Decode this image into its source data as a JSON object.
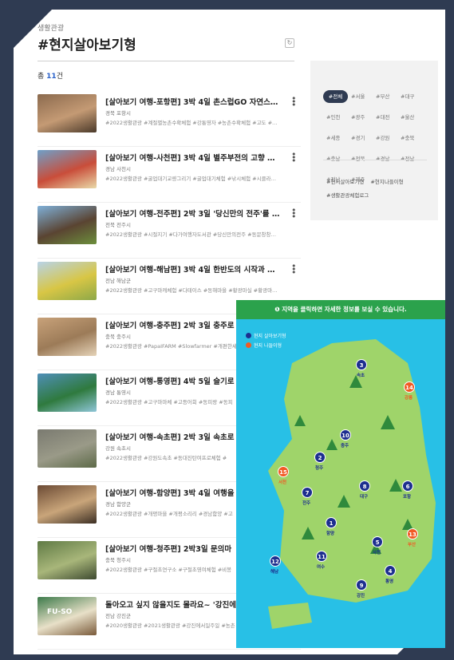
{
  "breadcrumb": "생활관광",
  "title": "#현지살아보기형",
  "count": {
    "prefix": "총 ",
    "n": "11",
    "suffix": "건"
  },
  "items": [
    {
      "title": "[살아보기 여행-포항편] 3박 4일 촌스럽GO 자연스…",
      "loc": "경북 포항시",
      "tags": "#2022생활관광 #계절별농촌수확체험 #강통영자 #농촌수확체험 #고도 #…",
      "thumb": [
        "#8b6a4e",
        "#c49a74",
        "#4b3a2a"
      ]
    },
    {
      "title": "[살아보기 여행-사천편] 3박 4일 별주부전의 고향 …",
      "loc": "경남 사천시",
      "tags": "#2022생활관광 #굴업대기교량그리기 #굴업대기체험 #낚시체험 #시클라…",
      "thumb": [
        "#6ea0c9",
        "#c94d3a",
        "#e9d9a8"
      ]
    },
    {
      "title": "[살아보기 여행-전주편] 2박 3일 '당신만의 전주'를 …",
      "loc": "전북 전주시",
      "tags": "#2022생활관광 #시절지기 #다가여행자도서관 #당신만의전주 #동문창창…",
      "thumb": [
        "#7fb0d8",
        "#5a4432",
        "#6c8f3c"
      ]
    },
    {
      "title": "[살아보기 여행-해남편] 3박 4일 한반도의 시작과 …",
      "loc": "전남 해남군",
      "tags": "#2022생활관광 #고구마캐체험 #다테이스 #동해마을 #황광마실 #황광마…",
      "thumb": [
        "#b8d3e8",
        "#d8c645",
        "#8da848"
      ]
    },
    {
      "title": "[살아보기 여행-충주편] 2박 3일 충주로",
      "loc": "충북 충주시",
      "tags": "#2022생활관광 #PapaIFARM #Slowfarmer #개편한세",
      "thumb": [
        "#c8a27a",
        "#9c7b58",
        "#e5d3b8"
      ]
    },
    {
      "title": "[살아보기 여행-통영편] 4박 5일 슬기로",
      "loc": "경남 통영시",
      "tags": "#2022생활관광 #고구마마체 #고등어회 #동피랑 #동피",
      "thumb": [
        "#4f8fb8",
        "#2f7a3e",
        "#8fc6d8"
      ]
    },
    {
      "title": "[살아보기 여행-속초편] 2박 3일 속초로",
      "loc": "강원 속초시",
      "tags": "#2022생활관광 #강원도속초 #동대진탄여프로체험 #",
      "thumb": [
        "#7a7a70",
        "#9a9a88",
        "#5d6a48"
      ]
    },
    {
      "title": "[살아보기 여행-함양편] 3박 4일 여행을",
      "loc": "경남 함양군",
      "tags": "#2022생활관광 #개평마을 #개평소리리 #경남함양 #고",
      "thumb": [
        "#6b4a34",
        "#c9a57a",
        "#3c2f24"
      ]
    },
    {
      "title": "[살아보기 여행-청주편] 2박3일 문의마",
      "loc": "충북 청주시",
      "tags": "#2022생활관광 #구절초연구소 #구절초영여체험 #비봉",
      "thumb": [
        "#5f7a44",
        "#a8b67a",
        "#3e4a30"
      ]
    },
    {
      "title": "돌아오고 싶지 않을지도 몰라요~ '강진에",
      "loc": "전남 강진군",
      "tags": "#2020생활관광 #2021생활관광 #강진에서일주일 #농촌",
      "thumb": [
        "#3c7a4a",
        "#e8e0c8",
        "#7a5a3a"
      ]
    }
  ],
  "thumb_text": "FU-SO",
  "filter": {
    "chips": [
      "#전체",
      "#서울",
      "#부산",
      "#대구",
      "#인천",
      "#광주",
      "#대전",
      "#울산",
      "#세종",
      "#경기",
      "#강원",
      "#충북",
      "#충남",
      "#전북",
      "#경남",
      "#전남",
      "#전남",
      "#제주"
    ],
    "links": [
      "#현지살아보기형",
      "#현지나들이형",
      "#생활관광체험로그"
    ]
  },
  "map": {
    "header": "❶ 지역을 클릭하면 자세한 정보를 보실 수 있습니다.",
    "legend": [
      {
        "label": "현지 살아보기형",
        "color": "#1d2f8f"
      },
      {
        "label": "현지 나들이형",
        "color": "#f15a24"
      }
    ],
    "land_color": "#9fd46a",
    "sea_color": "#28c0e6",
    "pins": [
      {
        "n": "3",
        "name": "속초",
        "type": "blue"
      },
      {
        "n": "14",
        "name": "강릉",
        "type": "orange"
      },
      {
        "n": "10",
        "name": "충주",
        "type": "blue"
      },
      {
        "n": "2",
        "name": "청주",
        "type": "blue"
      },
      {
        "n": "15",
        "name": "서천",
        "type": "orange"
      },
      {
        "n": "7",
        "name": "전주",
        "type": "blue"
      },
      {
        "n": "8",
        "name": "대구",
        "type": "blue"
      },
      {
        "n": "6",
        "name": "포항",
        "type": "blue"
      },
      {
        "n": "1",
        "name": "함양",
        "type": "blue"
      },
      {
        "n": "13",
        "name": "부산",
        "type": "orange"
      },
      {
        "n": "5",
        "name": "사천",
        "type": "blue"
      },
      {
        "n": "12",
        "name": "해남",
        "type": "blue"
      },
      {
        "n": "11",
        "name": "여수",
        "type": "blue"
      },
      {
        "n": "9",
        "name": "강진",
        "type": "blue"
      },
      {
        "n": "4",
        "name": "통영",
        "type": "blue"
      }
    ]
  }
}
